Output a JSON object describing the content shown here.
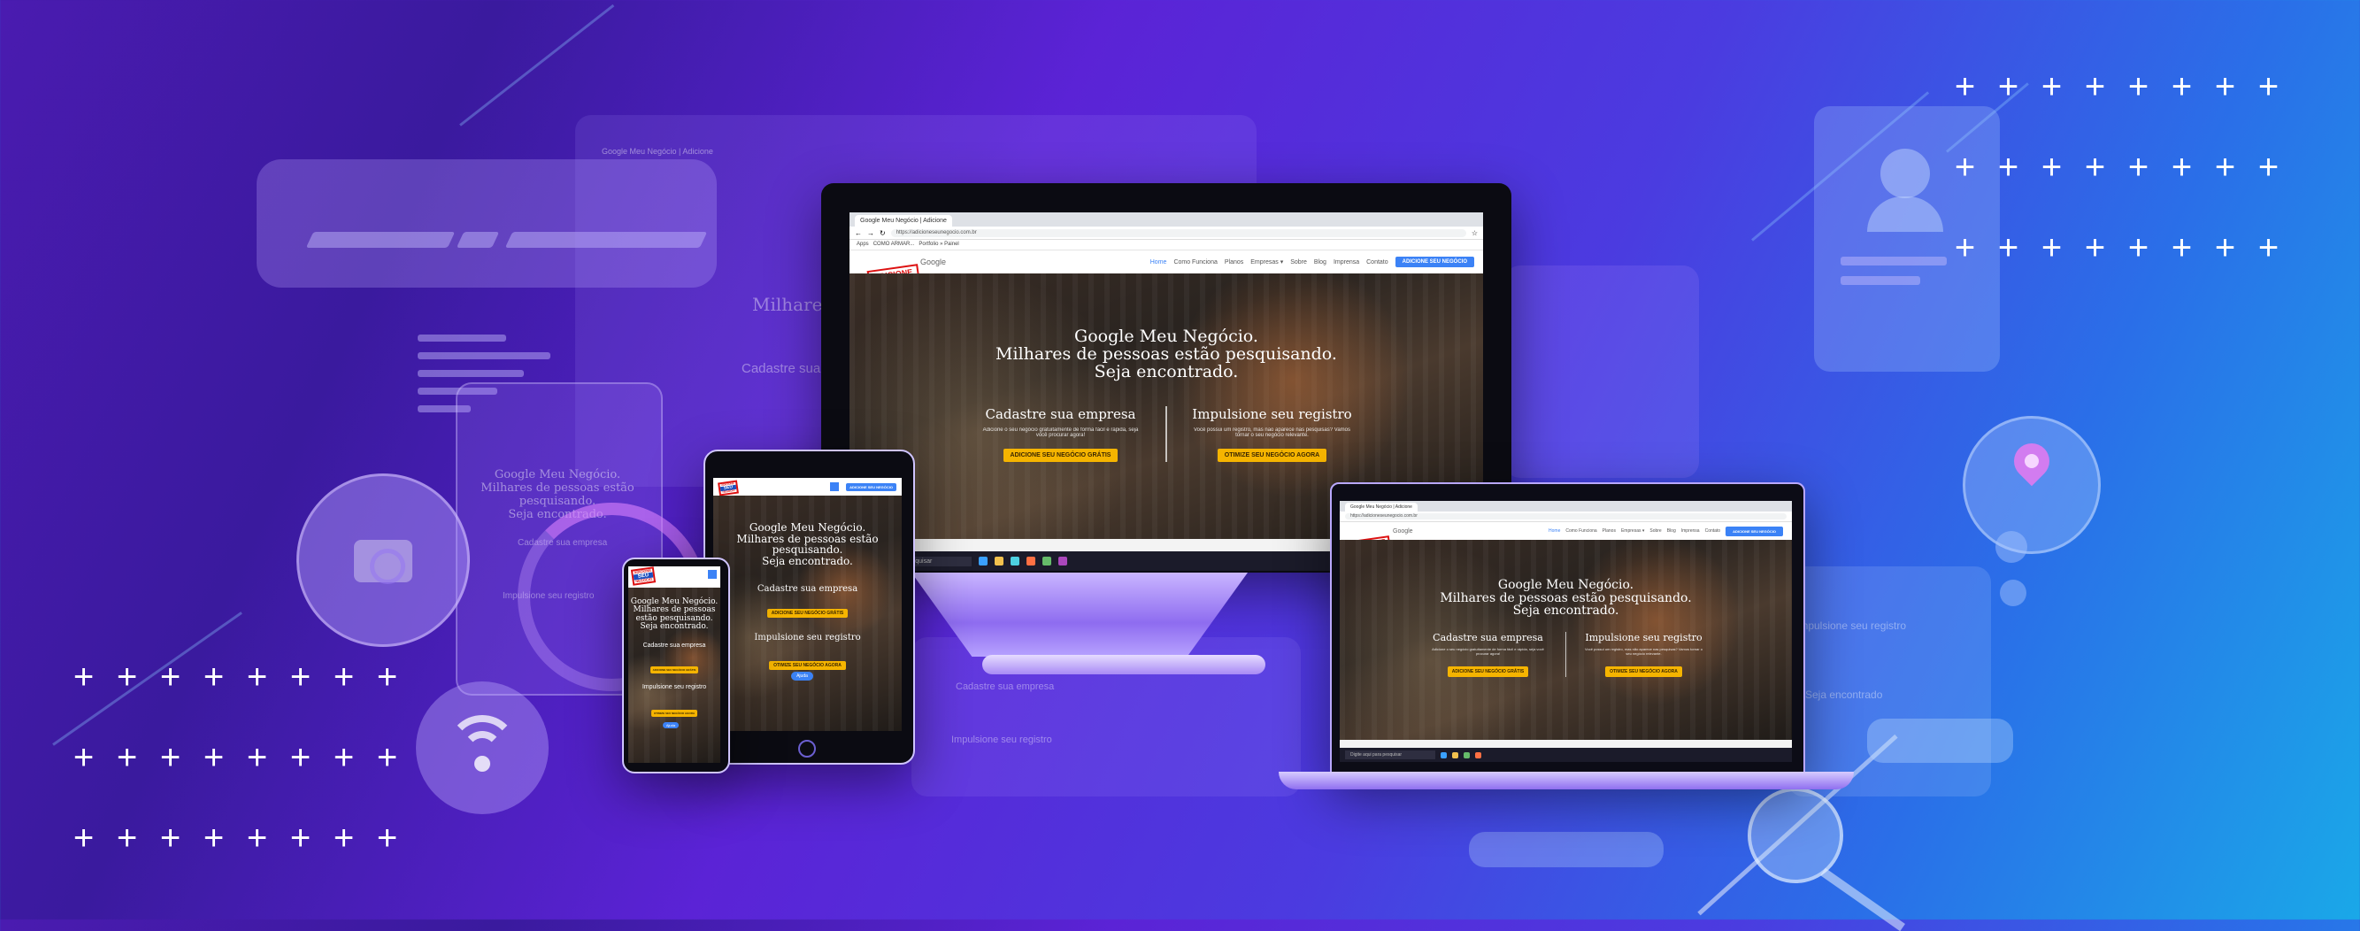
{
  "browser": {
    "tab_title": "Google Meu Negócio | Adicione",
    "tab_title_ghost": "Google Meu Negócio | Adicione",
    "url": "https://adicioneseunegocio.com.br",
    "url_laptop": "https://adicioneseunegocio.com.br",
    "bookmarks": [
      "Apps",
      "COMO ARMAR...",
      "Portfolio » Painel"
    ]
  },
  "logo": {
    "line1": "ADICIONE",
    "line2": "SEU",
    "line3": "NEGÓCIO",
    "google": "Google"
  },
  "nav": {
    "items": [
      "Home",
      "Como Funciona",
      "Planos",
      "Empresas ▾",
      "Sobre",
      "Blog",
      "Imprensa",
      "Contato"
    ],
    "cta": "ADICIONE SEU NEGÓCIO"
  },
  "hero": {
    "line1": "Google Meu Negócio.",
    "line2": "Milhares de pessoas estão pesquisando.",
    "line3": "Seja encontrado.",
    "col1_title": "Cadastre sua empresa",
    "col1_text": "Adicione o seu negócio gratuitamente de forma fácil e rápida, seja você procurar agora!",
    "col1_button": "ADICIONE SEU NEGÓCIO GRÁTIS",
    "col2_title": "Impulsione seu registro",
    "col2_text": "Você possui um registro, mas não aparece nas pesquisas? Vamos tornar o seu negócio relevante.",
    "col2_button": "OTIMIZE SEU NEGÓCIO AGORA"
  },
  "taskbar": {
    "search": "Digite aqui para pesquisar"
  },
  "ghost": {
    "title_a": "Milhares de",
    "title_b": "Cadastre sua",
    "phone_line1": "Google Meu Negócio.",
    "phone_line2": "Milhares de pessoas estão",
    "phone_line3": "pesquisando.",
    "phone_line4": "Seja encontrado.",
    "phone_c1": "Cadastre sua empresa",
    "phone_c2": "Impulsione seu registro",
    "stand_c1": "Cadastre sua empresa",
    "stand_c2": "Impulsione seu registro",
    "right_c1": "Impulsione seu registro",
    "right_c2": "Seja encontrado"
  },
  "tablet": {
    "line1": "Google Meu Negócio.",
    "line2": "Milhares de pessoas estão",
    "line3": "pesquisando.",
    "line4": "Seja encontrado.",
    "c1": "Cadastre sua empresa",
    "c1_btn": "ADICIONE SEU NEGÓCIO GRÁTIS",
    "c2": "Impulsione seu registro",
    "c2_btn": "OTIMIZE SEU NEGÓCIO AGORA",
    "chat": "Ajuda"
  },
  "phone": {
    "line1": "Google Meu Negócio.",
    "line2": "Milhares de pessoas",
    "line3": "estão pesquisando.",
    "line4": "Seja encontrado.",
    "c1": "Cadastre sua empresa",
    "c1_btn": "ADICIONE SEU NEGÓCIO GRÁTIS",
    "c2": "Impulsione seu registro",
    "c2_btn": "OTIMIZE SEU NEGÓCIO AGORA",
    "chat": "Ajuda"
  },
  "colors": {
    "accent": "#f5b400",
    "nav_cta": "#3b82f6",
    "logo_red": "#d11111",
    "logo_blue": "#1d4fbf"
  },
  "icons": [
    "camera-icon",
    "wifi-icon",
    "location-pin-icon",
    "user-profile-icon",
    "search-magnifier-icon"
  ]
}
